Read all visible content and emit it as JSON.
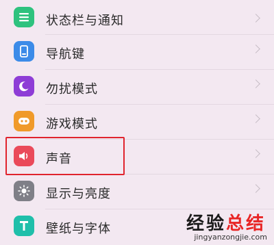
{
  "items": [
    {
      "label": "状态栏与通知",
      "icon": "notification-icon",
      "color": "#2ec27e"
    },
    {
      "label": "导航键",
      "icon": "navigation-icon",
      "color": "#3c8be8"
    },
    {
      "label": "勿扰模式",
      "icon": "moon-icon",
      "color": "#8e3dd6"
    },
    {
      "label": "游戏模式",
      "icon": "game-icon",
      "color": "#f09a2a"
    },
    {
      "label": "声音",
      "icon": "speaker-icon",
      "color": "#ea4a5a"
    },
    {
      "label": "显示与亮度",
      "icon": "sun-icon",
      "color": "#7f7f87"
    },
    {
      "label": "壁纸与字体",
      "icon": "font-icon",
      "color": "#1fbfaa"
    }
  ],
  "highlighted_item": "声音",
  "watermark": {
    "main_dark": "经验",
    "main_red": "总结",
    "sub": "jingyanzongjie.com"
  }
}
